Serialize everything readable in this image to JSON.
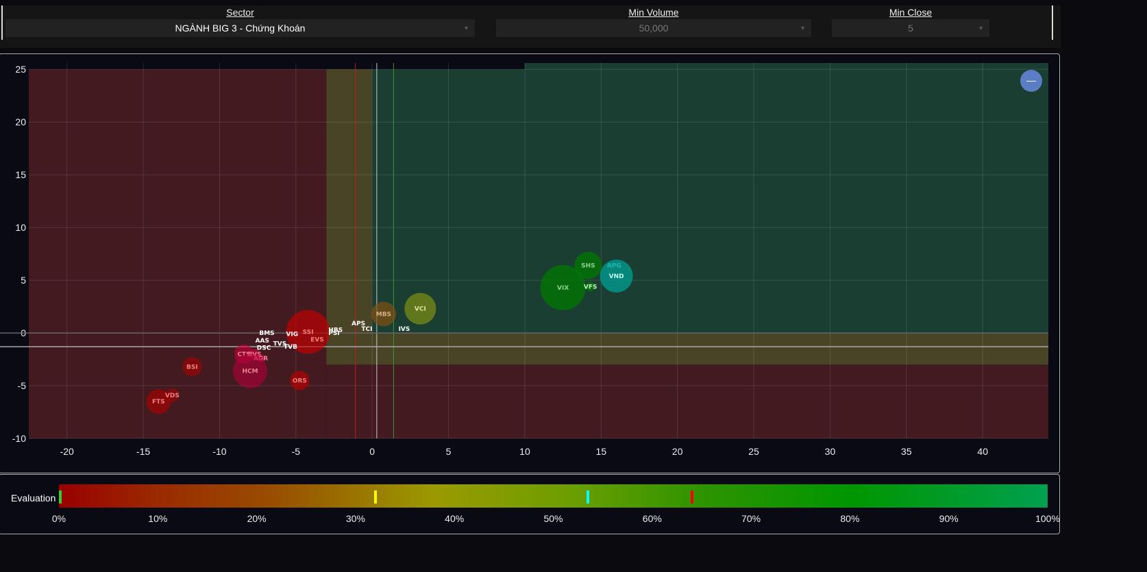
{
  "filters": {
    "sector": {
      "label": "Sector",
      "value": "NGÀNH BIG 3 - Chứng Khoán"
    },
    "min_volume": {
      "label": "Min Volume",
      "value": "50,000"
    },
    "min_close": {
      "label": "Min Close",
      "value": "5"
    }
  },
  "collapse_button": {
    "label": "—"
  },
  "chart_data": {
    "type": "scatter",
    "xlim": [
      -22.5,
      44.3
    ],
    "ylim": [
      -10,
      25.6
    ],
    "x_ticks": [
      -20,
      -15,
      -10,
      -5,
      0,
      5,
      10,
      15,
      20,
      25,
      30,
      35,
      40
    ],
    "y_ticks": [
      -10,
      -5,
      0,
      5,
      10,
      15,
      20,
      25
    ],
    "grid": true,
    "regions": [
      {
        "name": "weak",
        "x": [
          -22.5,
          -3
        ],
        "y": [
          -10,
          25
        ],
        "color": "#421a20"
      },
      {
        "name": "weak-low",
        "x": [
          -3,
          44.3
        ],
        "y": [
          -10,
          -3
        ],
        "color": "#421a20"
      },
      {
        "name": "neutral-v",
        "x": [
          -3,
          0
        ],
        "y": [
          -3,
          25
        ],
        "color": "#494426"
      },
      {
        "name": "neutral-h",
        "x": [
          -3,
          44.3
        ],
        "y": [
          -3,
          0
        ],
        "color": "#494426"
      },
      {
        "name": "strong",
        "x": [
          0,
          10
        ],
        "y": [
          0,
          25
        ],
        "color": "#1a3f32"
      },
      {
        "name": "strong-top",
        "x": [
          10,
          44.3
        ],
        "y": [
          0,
          25.6
        ],
        "color": "#1a3f32"
      }
    ],
    "ref_lines": [
      {
        "axis": "x",
        "value": -1.1,
        "color": "#c02020"
      },
      {
        "axis": "x",
        "value": 0.3,
        "color": "#cccccc"
      },
      {
        "axis": "x",
        "value": 1.4,
        "color": "#3a9a3a"
      },
      {
        "axis": "y",
        "value": -1.3,
        "color": "#aaaaaa"
      },
      {
        "axis": "y",
        "value": 0,
        "color": "#666666"
      }
    ],
    "points": [
      {
        "label": "SSI",
        "x": -4.2,
        "y": 0.1,
        "size": 32,
        "color": "rgba(200,0,0,0.65)",
        "text": "#f08080"
      },
      {
        "label": "EVS",
        "x": -3.6,
        "y": -0.6,
        "size": 0,
        "color": "none",
        "text": "#f08080"
      },
      {
        "label": "VIG",
        "x": -5.25,
        "y": -0.1,
        "size": 0,
        "color": "none",
        "text": "#fff"
      },
      {
        "label": "BMS",
        "x": -6.9,
        "y": 0,
        "size": 0,
        "color": "none",
        "text": "#fff"
      },
      {
        "label": "AAS",
        "x": -7.2,
        "y": -0.7,
        "size": 0,
        "color": "none",
        "text": "#fff"
      },
      {
        "label": "DSC",
        "x": -7.1,
        "y": -1.4,
        "size": 0,
        "color": "none",
        "text": "#fff"
      },
      {
        "label": "TVS",
        "x": -6.05,
        "y": -1.0,
        "size": 0,
        "color": "none",
        "text": "#fff"
      },
      {
        "label": "TVB",
        "x": -5.35,
        "y": -1.3,
        "size": 0,
        "color": "none",
        "text": "#fff"
      },
      {
        "label": "CTS",
        "x": -8.4,
        "y": -2.0,
        "size": 14,
        "color": "rgba(200,0,60,0.6)",
        "text": "#f08090"
      },
      {
        "label": "BVS",
        "x": -7.7,
        "y": -2.0,
        "size": 8,
        "color": "rgba(200,0,60,0.6)",
        "text": "#f08090"
      },
      {
        "label": "AGR",
        "x": -7.3,
        "y": -2.4,
        "size": 6,
        "color": "rgba(200,0,60,0.6)",
        "text": "#f08090"
      },
      {
        "label": "HCM",
        "x": -8.0,
        "y": -3.6,
        "size": 25,
        "color": "rgba(180,0,60,0.6)",
        "text": "#f08090"
      },
      {
        "label": "BSI",
        "x": -11.8,
        "y": -3.2,
        "size": 14,
        "color": "rgba(170,0,0,0.6)",
        "text": "#f08080"
      },
      {
        "label": "FTS",
        "x": -14.0,
        "y": -6.5,
        "size": 18,
        "color": "rgba(170,0,0,0.65)",
        "text": "#f08080"
      },
      {
        "label": "VDS",
        "x": -13.1,
        "y": -5.9,
        "size": 10,
        "color": "rgba(170,0,0,0.55)",
        "text": "#f08080"
      },
      {
        "label": "ORS",
        "x": -4.75,
        "y": -4.5,
        "size": 14,
        "color": "rgba(190,0,0,0.65)",
        "text": "#f08080"
      },
      {
        "label": "HBS",
        "x": -2.4,
        "y": 0.3,
        "size": 0,
        "color": "none",
        "text": "#fff"
      },
      {
        "label": "PSI",
        "x": -2.5,
        "y": 0,
        "size": 0,
        "color": "none",
        "text": "#fff"
      },
      {
        "label": "APS",
        "x": -0.9,
        "y": 0.9,
        "size": 0,
        "color": "none",
        "text": "#fff"
      },
      {
        "label": "TCI",
        "x": -0.35,
        "y": 0.4,
        "size": 0,
        "color": "none",
        "text": "#fff"
      },
      {
        "label": "IVS",
        "x": 2.1,
        "y": 0.4,
        "size": 0,
        "color": "none",
        "text": "#fff"
      },
      {
        "label": "MBS",
        "x": 0.75,
        "y": 1.8,
        "size": 18,
        "color": "rgba(130,80,20,0.7)",
        "text": "#d8b080"
      },
      {
        "label": "VCI",
        "x": 3.15,
        "y": 2.3,
        "size": 23,
        "color": "rgba(120,140,20,0.75)",
        "text": "#e0e0a0"
      },
      {
        "label": "VIX",
        "x": 12.5,
        "y": 4.3,
        "size": 33,
        "color": "rgba(0,120,0,0.75)",
        "text": "#90d090"
      },
      {
        "label": "SHS",
        "x": 14.15,
        "y": 6.4,
        "size": 20,
        "color": "rgba(0,120,0,0.75)",
        "text": "#90d090"
      },
      {
        "label": "VFS",
        "x": 14.3,
        "y": 4.4,
        "size": 7,
        "color": "rgba(0,120,0,0.75)",
        "text": "#c0f0c0"
      },
      {
        "label": "APG",
        "x": 15.85,
        "y": 6.4,
        "size": 0,
        "color": "none",
        "text": "#80f0f0"
      },
      {
        "label": "VND",
        "x": 16.0,
        "y": 5.4,
        "size": 24,
        "color": "rgba(0,160,150,0.75)",
        "text": "#c0f8f0"
      }
    ]
  },
  "evaluation": {
    "label": "Evaluation",
    "ticks": [
      "0%",
      "10%",
      "20%",
      "30%",
      "40%",
      "50%",
      "60%",
      "70%",
      "80%",
      "90%",
      "100%"
    ],
    "markers": [
      {
        "value": 0,
        "color": "#33cc33"
      },
      {
        "value": 32,
        "color": "#ffff00"
      },
      {
        "value": 53.5,
        "color": "#00ffff"
      },
      {
        "value": 64,
        "color": "#ff0000"
      }
    ]
  }
}
